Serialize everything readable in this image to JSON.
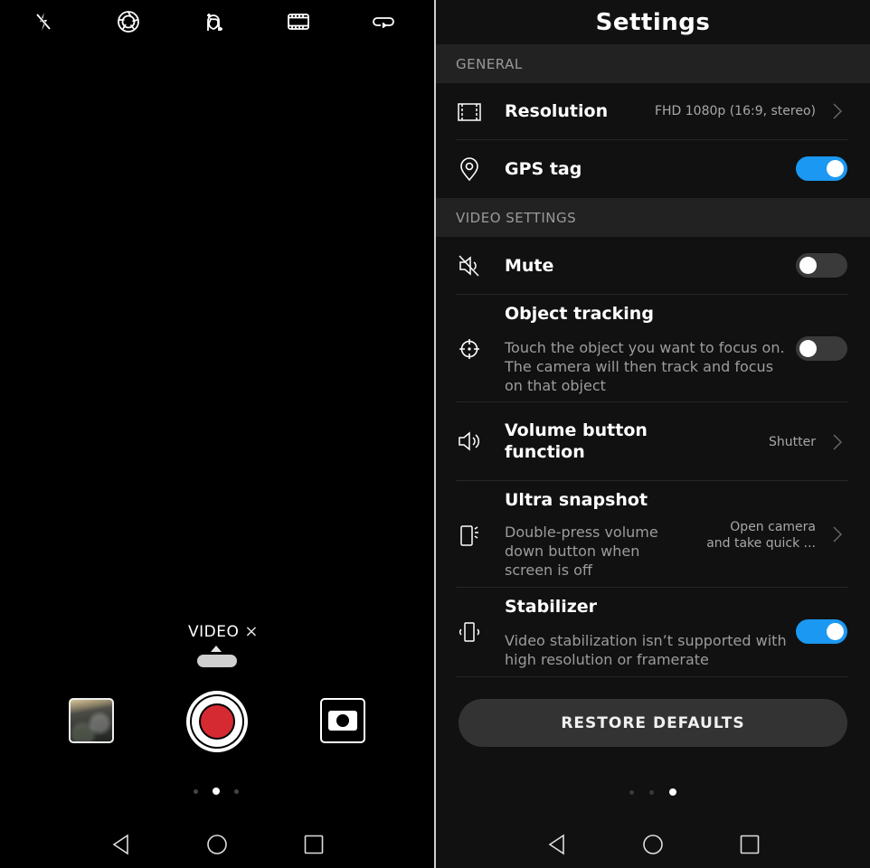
{
  "camera": {
    "top_icons": [
      {
        "name": "flash-off-icon"
      },
      {
        "name": "aperture-icon"
      },
      {
        "name": "beauty-icon"
      },
      {
        "name": "film-icon"
      },
      {
        "name": "loop-icon"
      }
    ],
    "mode": {
      "label": "VIDEO",
      "close_glyph": "×"
    },
    "shutter": {
      "record_color": "#d62a33"
    },
    "pager": {
      "count": 3,
      "active": 1
    },
    "nav": [
      "back",
      "home",
      "recents"
    ]
  },
  "settings": {
    "title": "Settings",
    "sections": {
      "general": "GENERAL",
      "video": "VIDEO SETTINGS"
    },
    "rows": {
      "resolution": {
        "title": "Resolution",
        "value": "FHD 1080p (16:9, stereo)"
      },
      "gps": {
        "title": "GPS tag",
        "enabled": true
      },
      "mute": {
        "title": "Mute",
        "enabled": false
      },
      "tracking": {
        "title": "Object tracking",
        "description": "Touch the object you want to focus on. The camera will then track and focus on that object",
        "enabled": false
      },
      "volume": {
        "title_line1": "Volume button",
        "title_line2": "function",
        "value": "Shutter"
      },
      "snapshot": {
        "title": "Ultra snapshot",
        "description": "Double-press volume down button when screen is off",
        "value_line1": "Open camera",
        "value_line2": "and take quick ..."
      },
      "stabilizer": {
        "title": "Stabilizer",
        "description": "Video stabilization isn’t supported with high resolution or framerate",
        "enabled": true
      }
    },
    "restore_label": "RESTORE DEFAULTS",
    "pager": {
      "count": 3,
      "active": 2
    },
    "accent": "#1b98f2"
  }
}
